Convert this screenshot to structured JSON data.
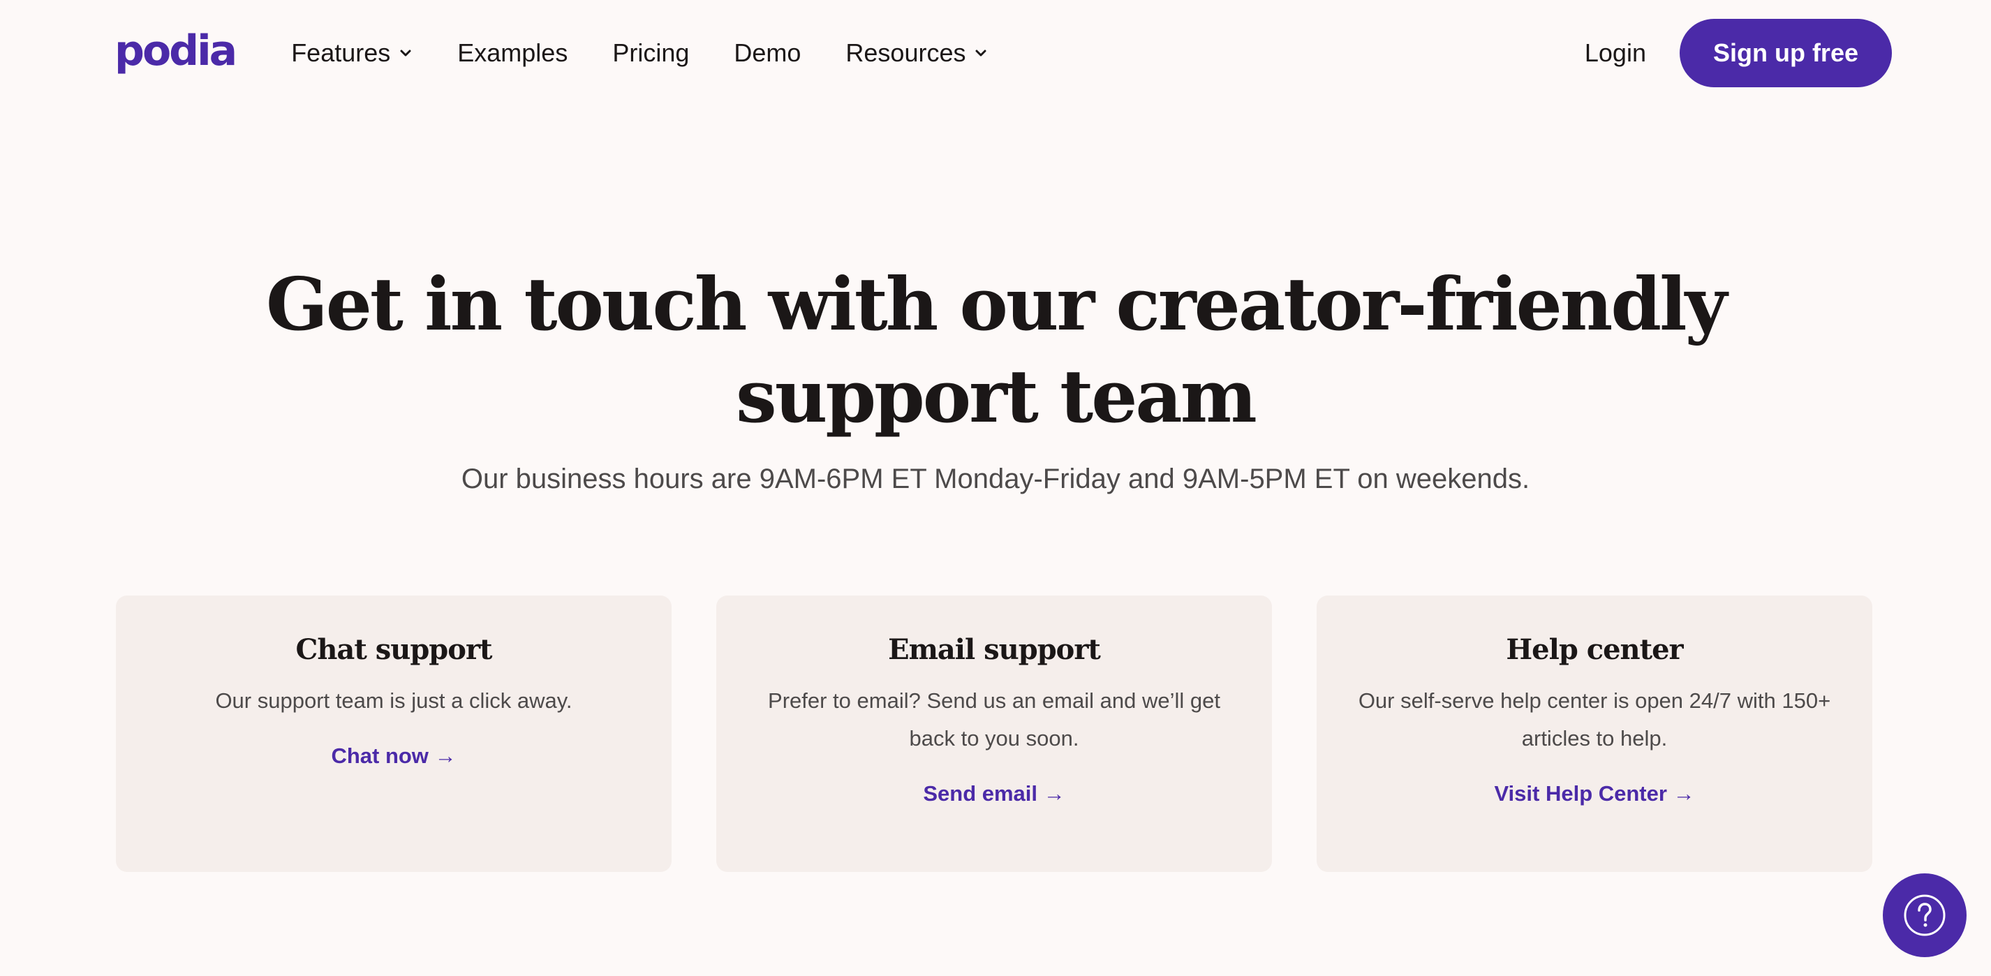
{
  "brand": {
    "logo_text": "podia",
    "accent_color": "#4b2aa8"
  },
  "nav": {
    "items": [
      {
        "label": "Features",
        "has_dropdown": true
      },
      {
        "label": "Examples",
        "has_dropdown": false
      },
      {
        "label": "Pricing",
        "has_dropdown": false
      },
      {
        "label": "Demo",
        "has_dropdown": false
      },
      {
        "label": "Resources",
        "has_dropdown": true
      }
    ],
    "login_label": "Login",
    "signup_label": "Sign up free"
  },
  "hero": {
    "title_line1": "Get in touch with our creator-friendly",
    "title_line2": "support team",
    "subtitle": "Our business hours are 9AM-6PM ET Monday-Friday and 9AM-5PM ET on weekends."
  },
  "cards": [
    {
      "title": "Chat support",
      "description": "Our support team is just a click away.",
      "link_label": "Chat now →"
    },
    {
      "title": "Email support",
      "description": "Prefer to email? Send us an email and we’ll get back to you soon.",
      "link_label": "Send email →"
    },
    {
      "title": "Help center",
      "description": "Our self-serve help center is open 24/7 with 150+ articles to help.",
      "link_label": "Visit Help Center →"
    }
  ],
  "help_widget": {
    "icon": "question-mark-icon"
  }
}
